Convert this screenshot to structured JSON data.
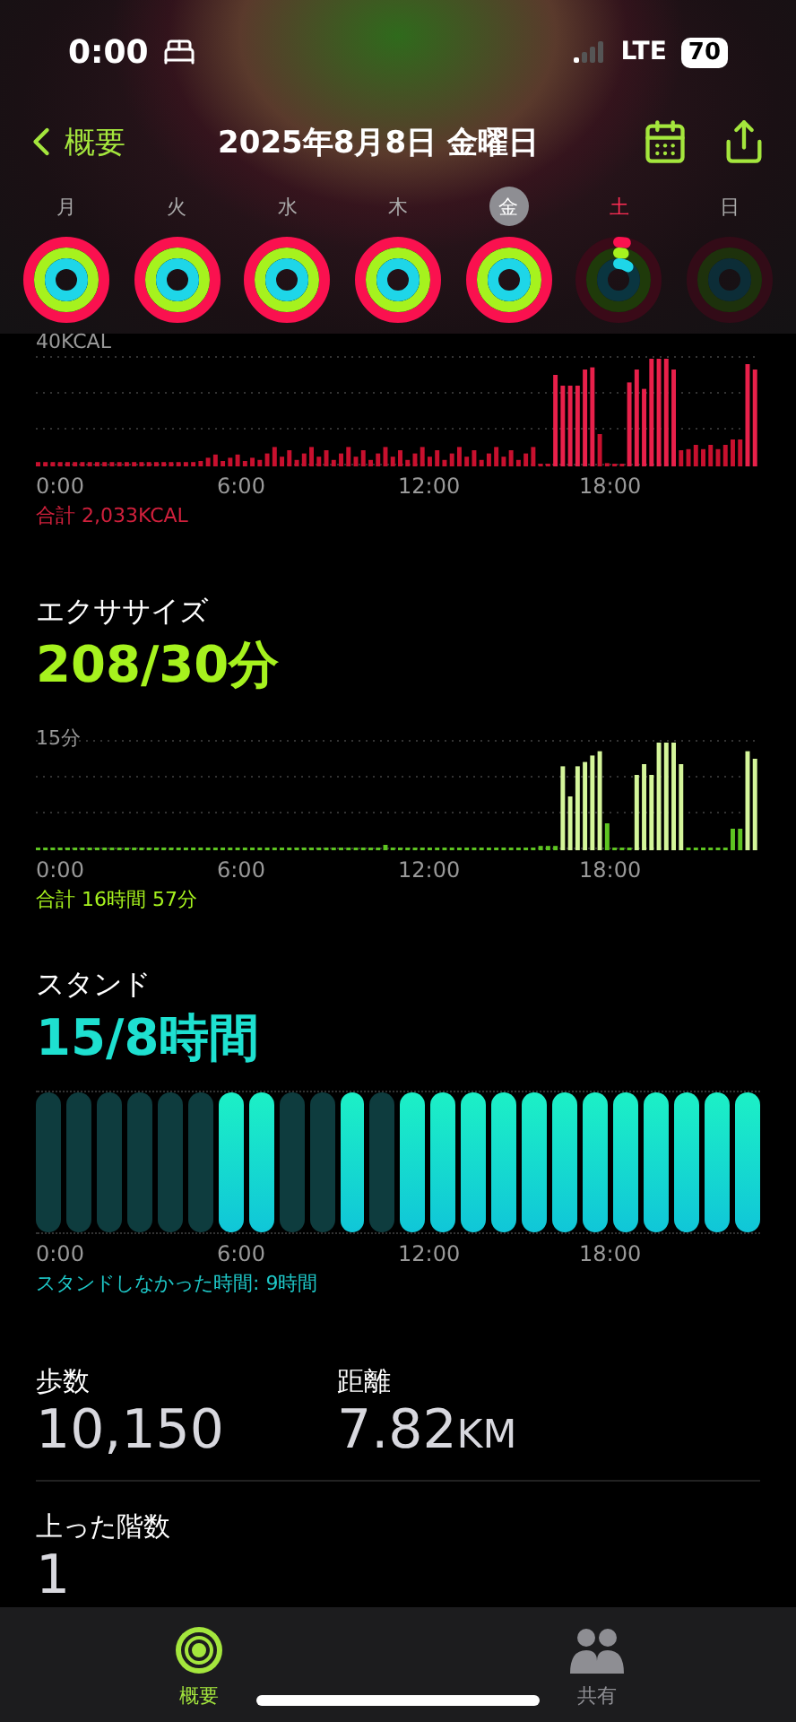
{
  "status_bar": {
    "time": "0:00",
    "network": "LTE",
    "battery": "70"
  },
  "nav": {
    "back": "概要",
    "title": "2025年8月8日 金曜日"
  },
  "days": [
    {
      "label": "月",
      "selected": false,
      "today": false,
      "closed": true,
      "active": true
    },
    {
      "label": "火",
      "selected": false,
      "today": false,
      "closed": true,
      "active": true
    },
    {
      "label": "水",
      "selected": false,
      "today": false,
      "closed": true,
      "active": true
    },
    {
      "label": "木",
      "selected": false,
      "today": false,
      "closed": true,
      "active": true
    },
    {
      "label": "金",
      "selected": true,
      "today": false,
      "closed": true,
      "active": true
    },
    {
      "label": "土",
      "selected": false,
      "today": true,
      "closed": false,
      "active": true
    },
    {
      "label": "日",
      "selected": false,
      "today": false,
      "closed": false,
      "active": false
    }
  ],
  "move": {
    "scale": "40KCAL",
    "ticks": [
      "0:00",
      "6:00",
      "12:00",
      "18:00"
    ],
    "total": "合計 2,033KCAL"
  },
  "exercise": {
    "title": "エクササイズ",
    "value": "208/30分",
    "scale": "15分",
    "ticks": [
      "0:00",
      "6:00",
      "12:00",
      "18:00"
    ],
    "total": "合計 16時間 57分"
  },
  "stand": {
    "title": "スタンド",
    "value": "15/8時間",
    "ticks": [
      "0:00",
      "6:00",
      "12:00",
      "18:00"
    ],
    "note": "スタンドしなかった時間: 9時間",
    "hours": [
      {
        "stood": false
      },
      {
        "stood": false
      },
      {
        "stood": false
      },
      {
        "stood": false
      },
      {
        "stood": false
      },
      {
        "stood": false
      },
      {
        "stood": true
      },
      {
        "stood": true
      },
      {
        "stood": false
      },
      {
        "stood": false
      },
      {
        "stood": true
      },
      {
        "stood": false
      },
      {
        "stood": true
      },
      {
        "stood": true
      },
      {
        "stood": true
      },
      {
        "stood": true
      },
      {
        "stood": true
      },
      {
        "stood": true
      },
      {
        "stood": true
      },
      {
        "stood": true
      },
      {
        "stood": true
      },
      {
        "stood": true
      },
      {
        "stood": true
      },
      {
        "stood": true
      }
    ]
  },
  "stats": [
    {
      "label": "歩数",
      "value": "10,150"
    },
    {
      "label": "距離",
      "value": "7.82",
      "unit": "KM"
    }
  ],
  "floors": {
    "label": "上った階数",
    "value": "1"
  },
  "tab_bar": [
    {
      "label": "概要",
      "selected": true
    },
    {
      "label": "共有",
      "selected": false
    }
  ]
}
